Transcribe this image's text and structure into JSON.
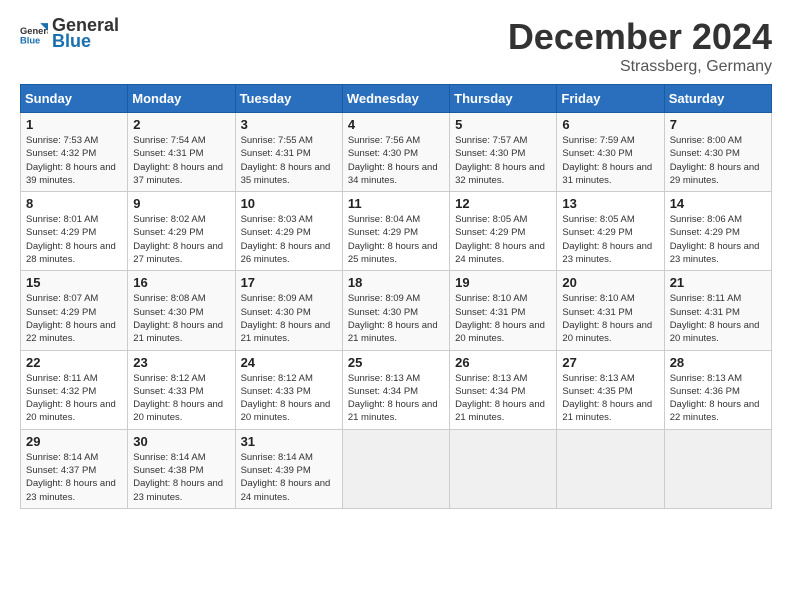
{
  "header": {
    "logo_general": "General",
    "logo_blue": "Blue",
    "month_title": "December 2024",
    "location": "Strassberg, Germany"
  },
  "days_of_week": [
    "Sunday",
    "Monday",
    "Tuesday",
    "Wednesday",
    "Thursday",
    "Friday",
    "Saturday"
  ],
  "weeks": [
    [
      {
        "day": "1",
        "sunrise": "7:53 AM",
        "sunset": "4:32 PM",
        "daylight": "8 hours and 39 minutes."
      },
      {
        "day": "2",
        "sunrise": "7:54 AM",
        "sunset": "4:31 PM",
        "daylight": "8 hours and 37 minutes."
      },
      {
        "day": "3",
        "sunrise": "7:55 AM",
        "sunset": "4:31 PM",
        "daylight": "8 hours and 35 minutes."
      },
      {
        "day": "4",
        "sunrise": "7:56 AM",
        "sunset": "4:30 PM",
        "daylight": "8 hours and 34 minutes."
      },
      {
        "day": "5",
        "sunrise": "7:57 AM",
        "sunset": "4:30 PM",
        "daylight": "8 hours and 32 minutes."
      },
      {
        "day": "6",
        "sunrise": "7:59 AM",
        "sunset": "4:30 PM",
        "daylight": "8 hours and 31 minutes."
      },
      {
        "day": "7",
        "sunrise": "8:00 AM",
        "sunset": "4:30 PM",
        "daylight": "8 hours and 29 minutes."
      }
    ],
    [
      {
        "day": "8",
        "sunrise": "8:01 AM",
        "sunset": "4:29 PM",
        "daylight": "8 hours and 28 minutes."
      },
      {
        "day": "9",
        "sunrise": "8:02 AM",
        "sunset": "4:29 PM",
        "daylight": "8 hours and 27 minutes."
      },
      {
        "day": "10",
        "sunrise": "8:03 AM",
        "sunset": "4:29 PM",
        "daylight": "8 hours and 26 minutes."
      },
      {
        "day": "11",
        "sunrise": "8:04 AM",
        "sunset": "4:29 PM",
        "daylight": "8 hours and 25 minutes."
      },
      {
        "day": "12",
        "sunrise": "8:05 AM",
        "sunset": "4:29 PM",
        "daylight": "8 hours and 24 minutes."
      },
      {
        "day": "13",
        "sunrise": "8:05 AM",
        "sunset": "4:29 PM",
        "daylight": "8 hours and 23 minutes."
      },
      {
        "day": "14",
        "sunrise": "8:06 AM",
        "sunset": "4:29 PM",
        "daylight": "8 hours and 23 minutes."
      }
    ],
    [
      {
        "day": "15",
        "sunrise": "8:07 AM",
        "sunset": "4:29 PM",
        "daylight": "8 hours and 22 minutes."
      },
      {
        "day": "16",
        "sunrise": "8:08 AM",
        "sunset": "4:30 PM",
        "daylight": "8 hours and 21 minutes."
      },
      {
        "day": "17",
        "sunrise": "8:09 AM",
        "sunset": "4:30 PM",
        "daylight": "8 hours and 21 minutes."
      },
      {
        "day": "18",
        "sunrise": "8:09 AM",
        "sunset": "4:30 PM",
        "daylight": "8 hours and 21 minutes."
      },
      {
        "day": "19",
        "sunrise": "8:10 AM",
        "sunset": "4:31 PM",
        "daylight": "8 hours and 20 minutes."
      },
      {
        "day": "20",
        "sunrise": "8:10 AM",
        "sunset": "4:31 PM",
        "daylight": "8 hours and 20 minutes."
      },
      {
        "day": "21",
        "sunrise": "8:11 AM",
        "sunset": "4:31 PM",
        "daylight": "8 hours and 20 minutes."
      }
    ],
    [
      {
        "day": "22",
        "sunrise": "8:11 AM",
        "sunset": "4:32 PM",
        "daylight": "8 hours and 20 minutes."
      },
      {
        "day": "23",
        "sunrise": "8:12 AM",
        "sunset": "4:33 PM",
        "daylight": "8 hours and 20 minutes."
      },
      {
        "day": "24",
        "sunrise": "8:12 AM",
        "sunset": "4:33 PM",
        "daylight": "8 hours and 20 minutes."
      },
      {
        "day": "25",
        "sunrise": "8:13 AM",
        "sunset": "4:34 PM",
        "daylight": "8 hours and 21 minutes."
      },
      {
        "day": "26",
        "sunrise": "8:13 AM",
        "sunset": "4:34 PM",
        "daylight": "8 hours and 21 minutes."
      },
      {
        "day": "27",
        "sunrise": "8:13 AM",
        "sunset": "4:35 PM",
        "daylight": "8 hours and 21 minutes."
      },
      {
        "day": "28",
        "sunrise": "8:13 AM",
        "sunset": "4:36 PM",
        "daylight": "8 hours and 22 minutes."
      }
    ],
    [
      {
        "day": "29",
        "sunrise": "8:14 AM",
        "sunset": "4:37 PM",
        "daylight": "8 hours and 23 minutes."
      },
      {
        "day": "30",
        "sunrise": "8:14 AM",
        "sunset": "4:38 PM",
        "daylight": "8 hours and 23 minutes."
      },
      {
        "day": "31",
        "sunrise": "8:14 AM",
        "sunset": "4:39 PM",
        "daylight": "8 hours and 24 minutes."
      },
      null,
      null,
      null,
      null
    ]
  ],
  "labels": {
    "sunrise": "Sunrise:",
    "sunset": "Sunset:",
    "daylight": "Daylight:"
  }
}
